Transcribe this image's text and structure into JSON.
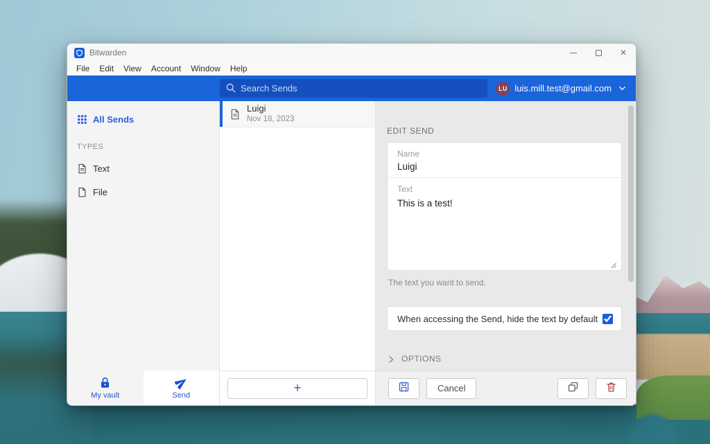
{
  "colors": {
    "brand_blue": "#175ddc",
    "header_blue": "#1b64d9",
    "danger_red": "#b5413f",
    "avatar_plum": "#81435a"
  },
  "titlebar": {
    "app_title": "Bitwarden"
  },
  "menubar": {
    "items": [
      "File",
      "Edit",
      "View",
      "Account",
      "Window",
      "Help"
    ]
  },
  "header": {
    "search_placeholder": "Search Sends",
    "account": {
      "initials": "LU",
      "email": "luis.mill.test@gmail.com"
    }
  },
  "sidebar": {
    "all_sends_label": "All Sends",
    "types_header": "TYPES",
    "types": [
      {
        "label": "Text",
        "icon": "file-text-icon"
      },
      {
        "label": "File",
        "icon": "file-icon"
      }
    ],
    "nav": [
      {
        "label": "My vault",
        "icon": "lock-icon",
        "active": false
      },
      {
        "label": "Send",
        "icon": "paper-plane-icon",
        "active": true
      }
    ]
  },
  "list": {
    "items": [
      {
        "title": "Luigi",
        "date": "Nov 18, 2023",
        "icon": "file-text-icon",
        "selected": true
      }
    ],
    "add_label": "+"
  },
  "detail": {
    "header": "EDIT SEND",
    "name_label": "Name",
    "name_value": "Luigi",
    "text_label": "Text",
    "text_value": "This is a test!",
    "helper": "The text you want to send.",
    "checkbox": {
      "label": "When accessing the Send, hide the text by default",
      "checked_attr": "checked"
    },
    "options_label": "OPTIONS",
    "cancel_label": "Cancel",
    "action_icons": [
      "save-icon",
      "copy-icon",
      "trash-icon"
    ]
  }
}
